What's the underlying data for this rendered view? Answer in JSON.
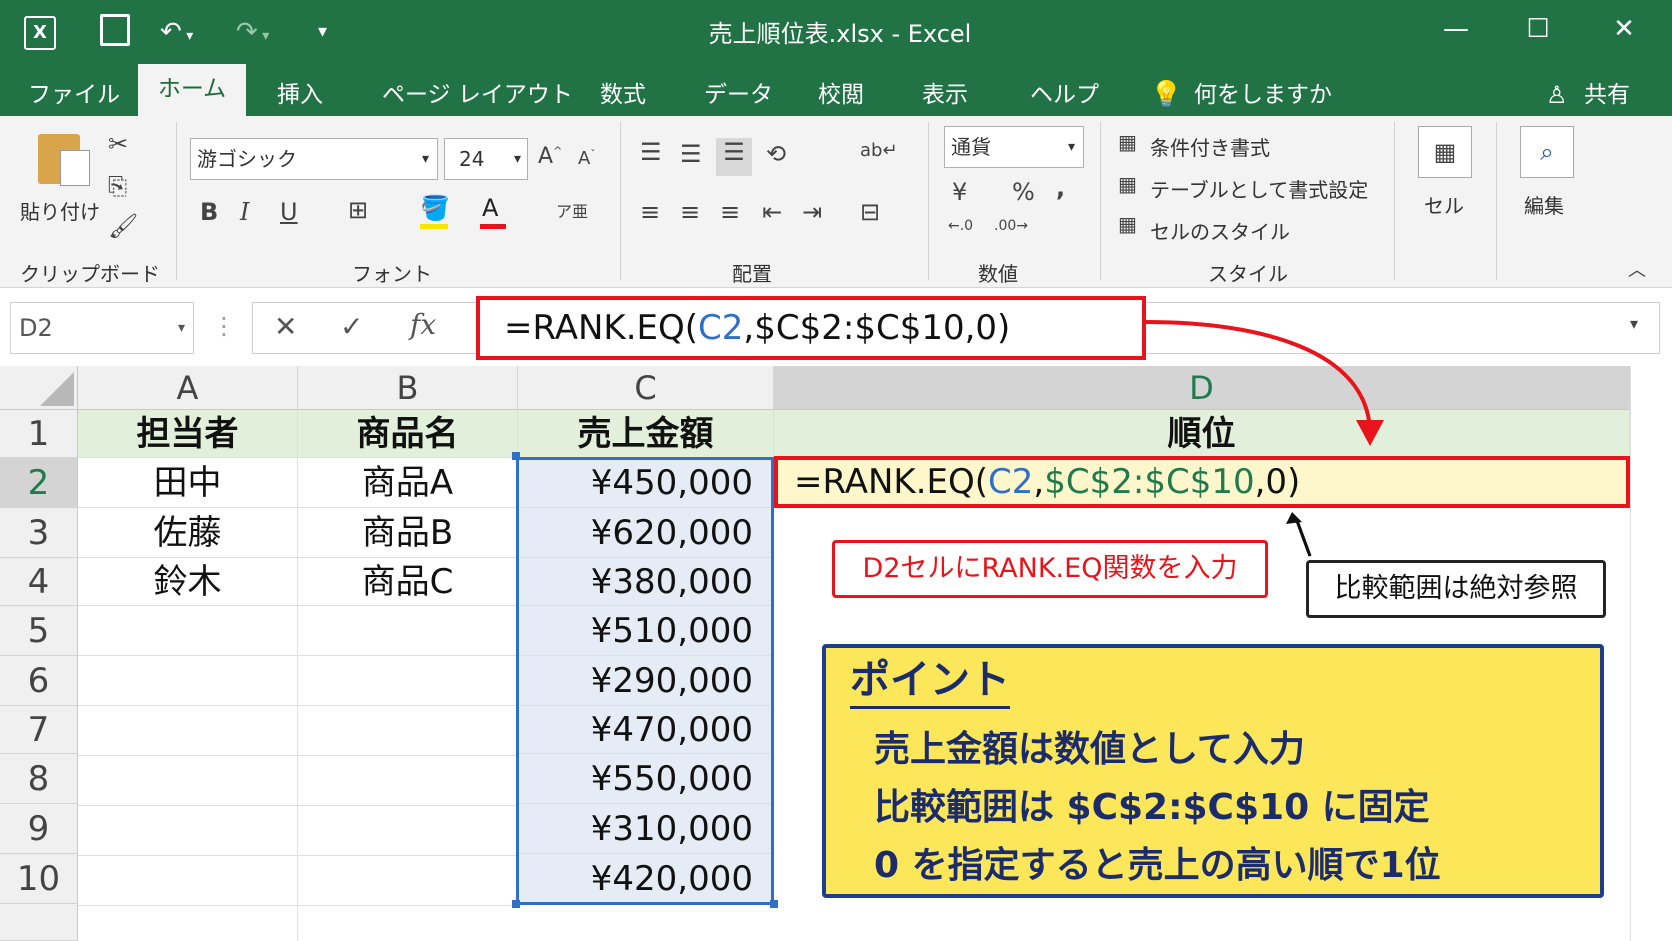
{
  "titlebar": {
    "title": "売上順位表.xlsx  -  Excel"
  },
  "menu": {
    "file": "ファイル",
    "home": "ホーム",
    "insert": "挿入",
    "page_layout": "ページ レイアウト",
    "formulas": "数式",
    "data": "データ",
    "review": "校閲",
    "view": "表示",
    "help": "ヘルプ",
    "tell_me": "何をしますか",
    "share": "共有"
  },
  "ribbon": {
    "paste": "貼り付け",
    "clipboard": "クリップボード",
    "font_name": "游ゴシック",
    "font_size": "24",
    "font_group": "フォント",
    "align_group": "配置",
    "number_format": "通貨",
    "number_group": "数値",
    "cond_format": "条件付き書式",
    "table_format": "テーブルとして書式設定",
    "cell_style": "セルのスタイル",
    "style_group": "スタイル",
    "cell": "セル",
    "edit": "編集",
    "bold": "B",
    "italic": "I",
    "underline": "U",
    "yen": "¥",
    "percent": "%",
    "comma": ","
  },
  "formula_bar": {
    "name_box": "D2",
    "formula_prefix": "=RANK.EQ(",
    "formula_ref": "C2",
    "formula_rest": ",$C$2:$C$10,0)"
  },
  "columns": [
    "A",
    "B",
    "C",
    "D"
  ],
  "rows": [
    "1",
    "2",
    "3",
    "4",
    "5",
    "6",
    "7",
    "8",
    "9",
    "10"
  ],
  "sheet": {
    "headers": [
      "担当者",
      "商品名",
      "売上金額",
      "順位"
    ],
    "names": [
      "田中",
      "佐藤",
      "鈴木"
    ],
    "products": [
      "商品A",
      "商品B",
      "商品C"
    ],
    "sales": [
      "¥450,000",
      "¥620,000",
      "¥380,000",
      "¥510,000",
      "¥290,000",
      "¥470,000",
      "¥550,000",
      "¥310,000",
      "¥420,000"
    ],
    "d2_prefix": "=RANK.EQ(",
    "d2_ref": "C2",
    "d2_comma": ",",
    "d2_range": "$C$2:$C$10",
    "d2_tail": ",0)"
  },
  "annotations": {
    "red_note": "D2セルにRANK.EQ関数を入力",
    "black_note": "比較範囲は絶対参照"
  },
  "point": {
    "title": "ポイント",
    "lines": [
      "売上金額は数値として入力",
      "比較範囲は $C$2:$C$10 に固定",
      "0 を指定すると売上の高い順で1位"
    ]
  },
  "colors": {
    "excel_green": "#217346",
    "highlight_red": "#e8141b",
    "point_yellow": "#fce75a",
    "point_navy": "#1c3e8e"
  }
}
